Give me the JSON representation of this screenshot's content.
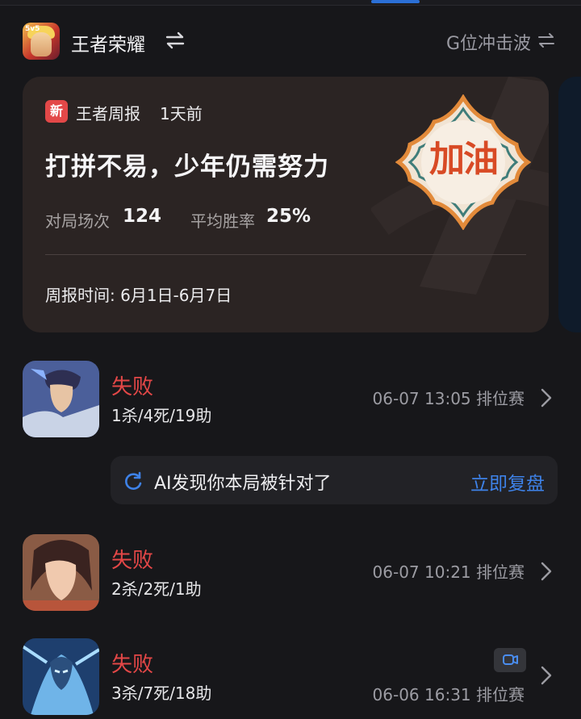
{
  "header": {
    "app_name": "王者荣耀",
    "app_icon_tag": "5v5",
    "rank_label": "G位冲击波"
  },
  "report": {
    "badge": "新",
    "title": "王者周报",
    "time_ago": "1天前",
    "headline": "打拼不易，少年仍需努力",
    "stats": [
      {
        "label": "对局场次",
        "value": "124"
      },
      {
        "label": "平均胜率",
        "value": "25%"
      }
    ],
    "period": "周报时间: 6月1日-6月7日",
    "cheer": "加油"
  },
  "matches": [
    {
      "result": "失败",
      "kda": "1杀/4死/19助",
      "time": "06-07 13:05 排位赛",
      "has_video": false
    },
    {
      "result": "失败",
      "kda": "2杀/2死/1助",
      "time": "06-07 10:21 排位赛",
      "has_video": false
    },
    {
      "result": "失败",
      "kda": "3杀/7死/18助",
      "time": "06-06 16:31 排位赛",
      "has_video": true
    }
  ],
  "ai_tip": {
    "text": "AI发现你本局被针对了",
    "action": "立即复盘"
  },
  "colors": {
    "background": "#17171a",
    "card": "#2b2423",
    "defeat": "#e34747",
    "accent": "#3e82e8",
    "new_badge": "#e34848"
  },
  "icons": [
    "swap-icon",
    "refresh-icon",
    "chevron-right-icon",
    "video-icon"
  ]
}
